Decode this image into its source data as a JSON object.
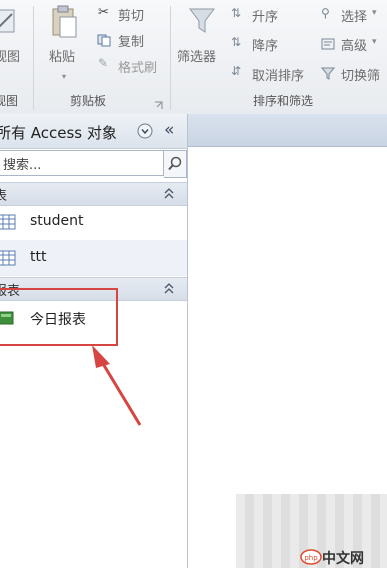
{
  "ribbon": {
    "view_label": "视图",
    "view_group": "视图",
    "paste_label": "粘贴",
    "cut_label": "剪切",
    "copy_label": "复制",
    "format_painter_label": "格式刷",
    "clipboard_group": "剪贴板",
    "filter_label": "筛选器",
    "ascending_label": "升序",
    "descending_label": "降序",
    "remove_sort_label": "取消排序",
    "selection_label": "选择",
    "advanced_label": "高级",
    "toggle_filter_label": "切换筛",
    "sort_filter_group": "排序和筛选"
  },
  "nav": {
    "title": "所有 Access 对象",
    "search_placeholder": "搜索...",
    "sections": [
      {
        "label": "表",
        "items": [
          "student",
          "ttt"
        ]
      },
      {
        "label": "报表",
        "items": [
          "今日报表"
        ]
      }
    ]
  },
  "watermark": {
    "text": "中文网",
    "logo": "php"
  },
  "colors": {
    "accent_red": "#d64541",
    "header_blue": "#dce3ec"
  }
}
